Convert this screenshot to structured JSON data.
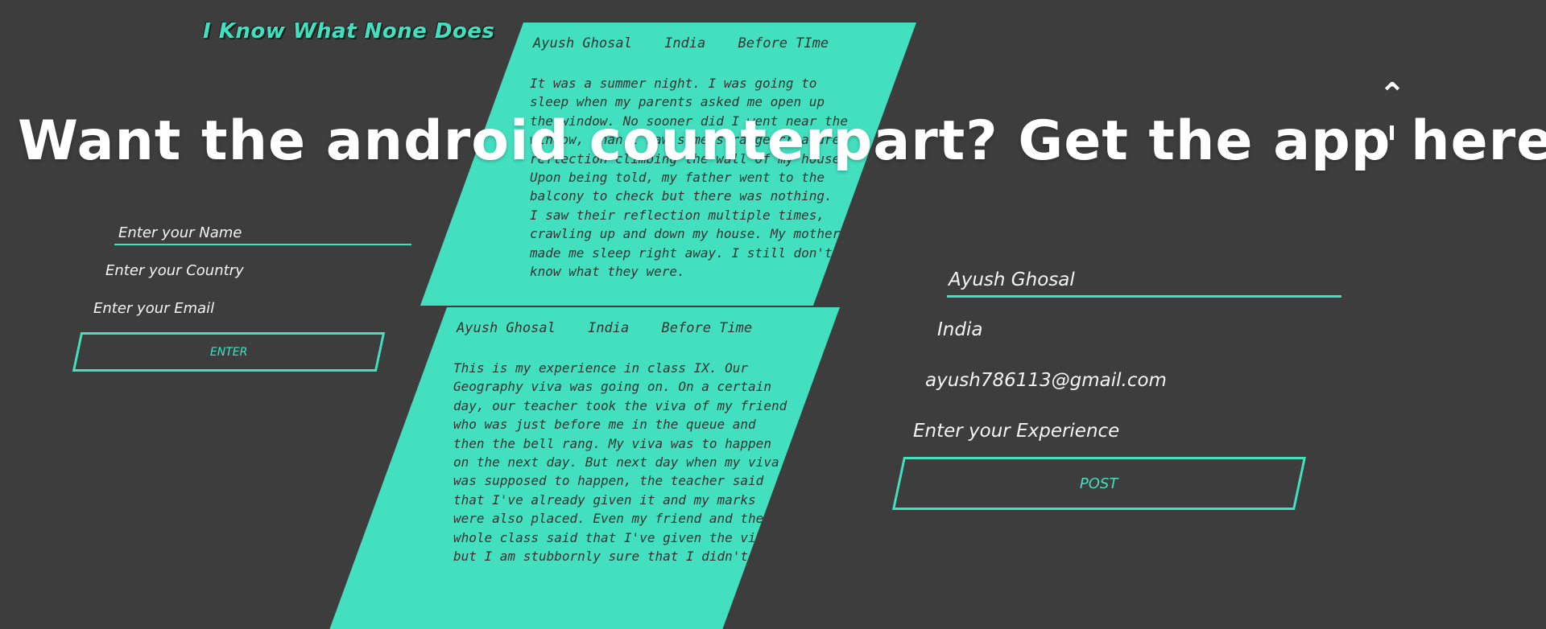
{
  "app": {
    "brand": "I Know What None Does"
  },
  "feed": [
    {
      "name": "Ayush Ghosal",
      "country": "India",
      "time": "Before TIme",
      "lines": [
        "It was a summer night. I was going to",
        "sleep when my parents asked me open up",
        "the window. No sooner did I went near the",
        "window, than I saw some strange creature",
        "reflection climbing the wall of my house.",
        "Upon being told, my father went to the",
        "balcony to check but there was nothing.",
        "I saw their reflection multiple times,",
        "crawling up and down my house. My mother",
        "made me sleep right away. I still don't",
        "know what they were."
      ]
    },
    {
      "name": "Ayush Ghosal",
      "country": "India",
      "time": "Before Time",
      "lines": [
        "This is my experience in class IX. Our",
        "Geography viva was going on. On a certain",
        "day, our teacher took the viva of my friend",
        "who was just before me in the queue and",
        "then the bell rang. My viva was to happen",
        "on the next day. But next day when my viva",
        "was supposed to happen, the teacher said",
        "that I've already given it and my marks",
        "were also placed. Even my friend and the",
        "whole class said that I've given the viva",
        "but I am stubbornly sure that I didn't give"
      ]
    }
  ],
  "left_form": {
    "name_placeholder": "Enter your Name",
    "country_placeholder": "Enter your Country",
    "email_placeholder": "Enter your Email",
    "enter_label": "ENTER"
  },
  "right_form": {
    "name_value": "Ayush Ghosal",
    "country_value": "India",
    "email_value": "ayush786113@gmail.com",
    "experience_placeholder": "Enter your Experience",
    "post_label": "POST"
  },
  "banner": {
    "text": "Want the android counterpart? Get the app here -"
  },
  "colors": {
    "background": "#3d3d3d",
    "accent": "#43e0c0",
    "text": "#f4f4f4"
  },
  "icons": {
    "collapse": "caret-up-icon"
  }
}
